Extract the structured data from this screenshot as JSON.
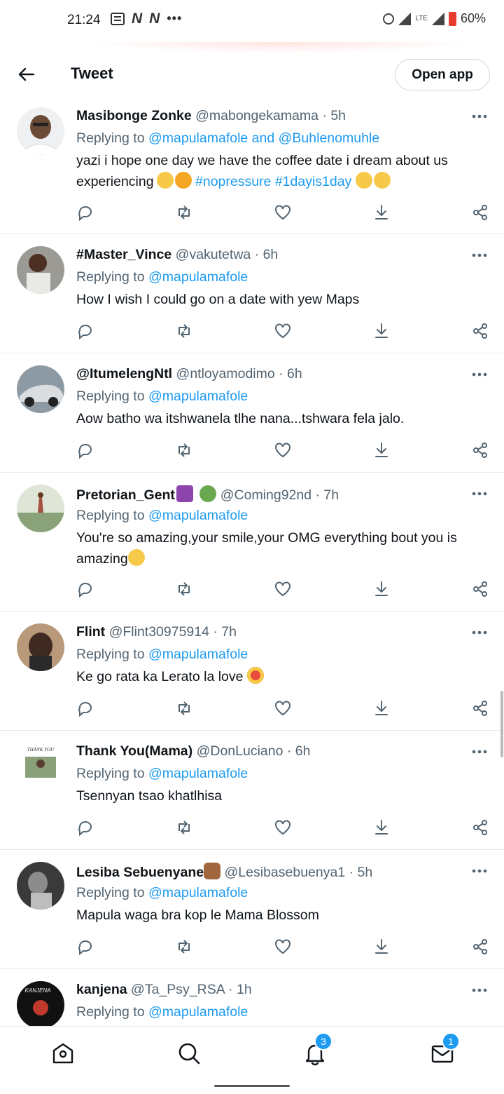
{
  "status_bar": {
    "time": "21:24",
    "battery": "60%",
    "network": "LTE",
    "extra": "•••"
  },
  "header": {
    "title": "Tweet",
    "open_app_label": "Open app"
  },
  "tweets": [
    {
      "name": "Masibonge Zonke",
      "handle": "@mabongekamama · 5h",
      "replying_label": "Replying to ",
      "replying_to": "@mapulamafole and @Buhlenomuhle",
      "text_parts": [
        "yazi i hope one day we have the coffee date  i dream about us experiencing",
        "#nopressure #1dayis1day"
      ]
    },
    {
      "name": "#Master_Vince",
      "handle": "@vakutetwa · 6h",
      "replying_label": "Replying to ",
      "replying_to": "@mapulamafole",
      "text": "How I wish I could go on a date with yew Maps"
    },
    {
      "name": "@ItumelengNtl",
      "handle": "@ntloyamodimo · 6h",
      "replying_label": "Replying to ",
      "replying_to": "@mapulamafole",
      "text": "Aow batho wa itshwanela tlhe nana...tshwara fela jalo."
    },
    {
      "name": "Pretorian_Gent",
      "handle": "@Coming92nd · 7h",
      "replying_label": "Replying to ",
      "replying_to": "@mapulamafole",
      "text": "You're so amazing,your smile,your OMG everything bout you is amazing"
    },
    {
      "name": "Flint",
      "handle": "@Flint30975914 · 7h",
      "replying_label": "Replying to ",
      "replying_to": "@mapulamafole",
      "text": "Ke go rata ka Lerato la love"
    },
    {
      "name": "Thank You(Mama)",
      "handle": "@DonLuciano · 6h",
      "replying_label": "Replying to ",
      "replying_to": "@mapulamafole",
      "text": "Tsennyan tsao khatlhisa",
      "avatar_caption": "THANK YOU"
    },
    {
      "name": "Lesiba Sebuenyane",
      "handle": "@Lesibasebuenya1 · 5h",
      "replying_label": "Replying to ",
      "replying_to": "@mapulamafole",
      "text": "Mapula waga bra kop le Mama Blossom"
    },
    {
      "name": "kanjena",
      "handle": "@Ta_Psy_RSA · 1h",
      "replying_label": "Replying to ",
      "replying_to": "@mapulamafole",
      "avatar_caption": "KANJENA"
    }
  ],
  "bottom_nav": {
    "items": [
      "home-icon",
      "search-icon",
      "notifications-icon",
      "messages-icon"
    ],
    "notifications_badge": "3",
    "messages_badge": "1"
  },
  "colors": {
    "accent": "#1d9bf0",
    "text": "#0f1419",
    "muted": "#536471",
    "divider": "#e7e9ea"
  }
}
